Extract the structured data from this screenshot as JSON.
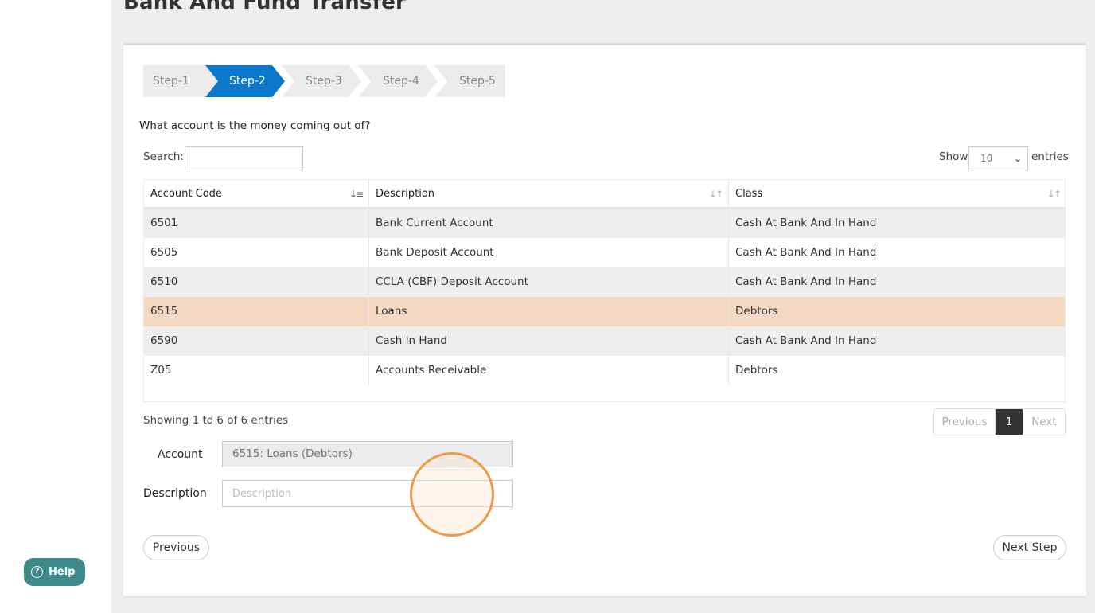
{
  "page": {
    "title": "Bank And Fund Transfer"
  },
  "steps": [
    {
      "label": "Step-1",
      "active": false
    },
    {
      "label": "Step-2",
      "active": true
    },
    {
      "label": "Step-3",
      "active": false
    },
    {
      "label": "Step-4",
      "active": false
    },
    {
      "label": "Step-5",
      "active": false
    }
  ],
  "question": "What account is the money coming out of?",
  "search": {
    "label": "Search:",
    "value": ""
  },
  "length": {
    "show_label": "Show",
    "value": "10",
    "entries_label": "entries"
  },
  "table": {
    "columns": [
      {
        "label": "Account Code",
        "sort_icon": "sort-asc-icon"
      },
      {
        "label": "Description",
        "sort_icon": "sort-both-icon"
      },
      {
        "label": "Class",
        "sort_icon": "sort-both-icon"
      }
    ],
    "rows": [
      {
        "code": "6501",
        "description": "Bank Current Account",
        "class": "Cash At Bank And In Hand",
        "selected": false
      },
      {
        "code": "6505",
        "description": "Bank Deposit Account",
        "class": "Cash At Bank And In Hand",
        "selected": false
      },
      {
        "code": "6510",
        "description": "CCLA (CBF) Deposit Account",
        "class": "Cash At Bank And In Hand",
        "selected": false
      },
      {
        "code": "6515",
        "description": "Loans",
        "class": "Debtors",
        "selected": true
      },
      {
        "code": "6590",
        "description": "Cash In Hand",
        "class": "Cash At Bank And In Hand",
        "selected": false
      },
      {
        "code": "Z05",
        "description": "Accounts Receivable",
        "class": "Debtors",
        "selected": false
      }
    ]
  },
  "info": "Showing 1 to 6 of 6 entries",
  "pagination": {
    "previous": "Previous",
    "current": "1",
    "next": "Next"
  },
  "form": {
    "account_label": "Account",
    "account_value": "6515: Loans (Debtors)",
    "description_label": "Description",
    "description_placeholder": "Description"
  },
  "buttons": {
    "previous": "Previous",
    "next_step": "Next Step"
  },
  "help": {
    "icon": "?",
    "label": "Help"
  },
  "colors": {
    "accent": "#0b78cc",
    "selected_row": "#f4d8c0",
    "help": "#3e8a8b",
    "click_ring": "#ef9a45"
  }
}
